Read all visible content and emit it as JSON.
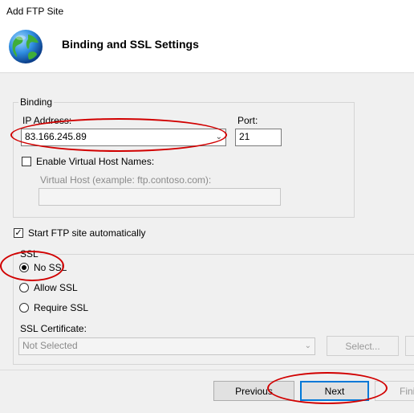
{
  "window": {
    "title": "Add FTP Site"
  },
  "header": {
    "title": "Binding and SSL Settings",
    "icon": "globe-icon"
  },
  "binding": {
    "group_label": "Binding",
    "ip_label": "IP Address:",
    "ip_value": "83.166.245.89",
    "port_label": "Port:",
    "port_value": "21",
    "virtual_host_checkbox": "Enable Virtual Host Names:",
    "virtual_host_checked": false,
    "virtual_host_label": "Virtual Host (example: ftp.contoso.com):",
    "virtual_host_value": ""
  },
  "start_auto": {
    "label": "Start FTP site automatically",
    "checked": true
  },
  "ssl": {
    "group_label": "SSL",
    "options": [
      {
        "label": "No SSL",
        "selected": true
      },
      {
        "label": "Allow SSL",
        "selected": false
      },
      {
        "label": "Require SSL",
        "selected": false
      }
    ],
    "certificate_label": "SSL Certificate:",
    "certificate_value": "Not Selected",
    "select_button": "Select..."
  },
  "buttons": {
    "previous": "Previous",
    "next": "Next",
    "finish": "Fini"
  },
  "annotation_color": "#d10000",
  "accent_color": "#0078d7"
}
